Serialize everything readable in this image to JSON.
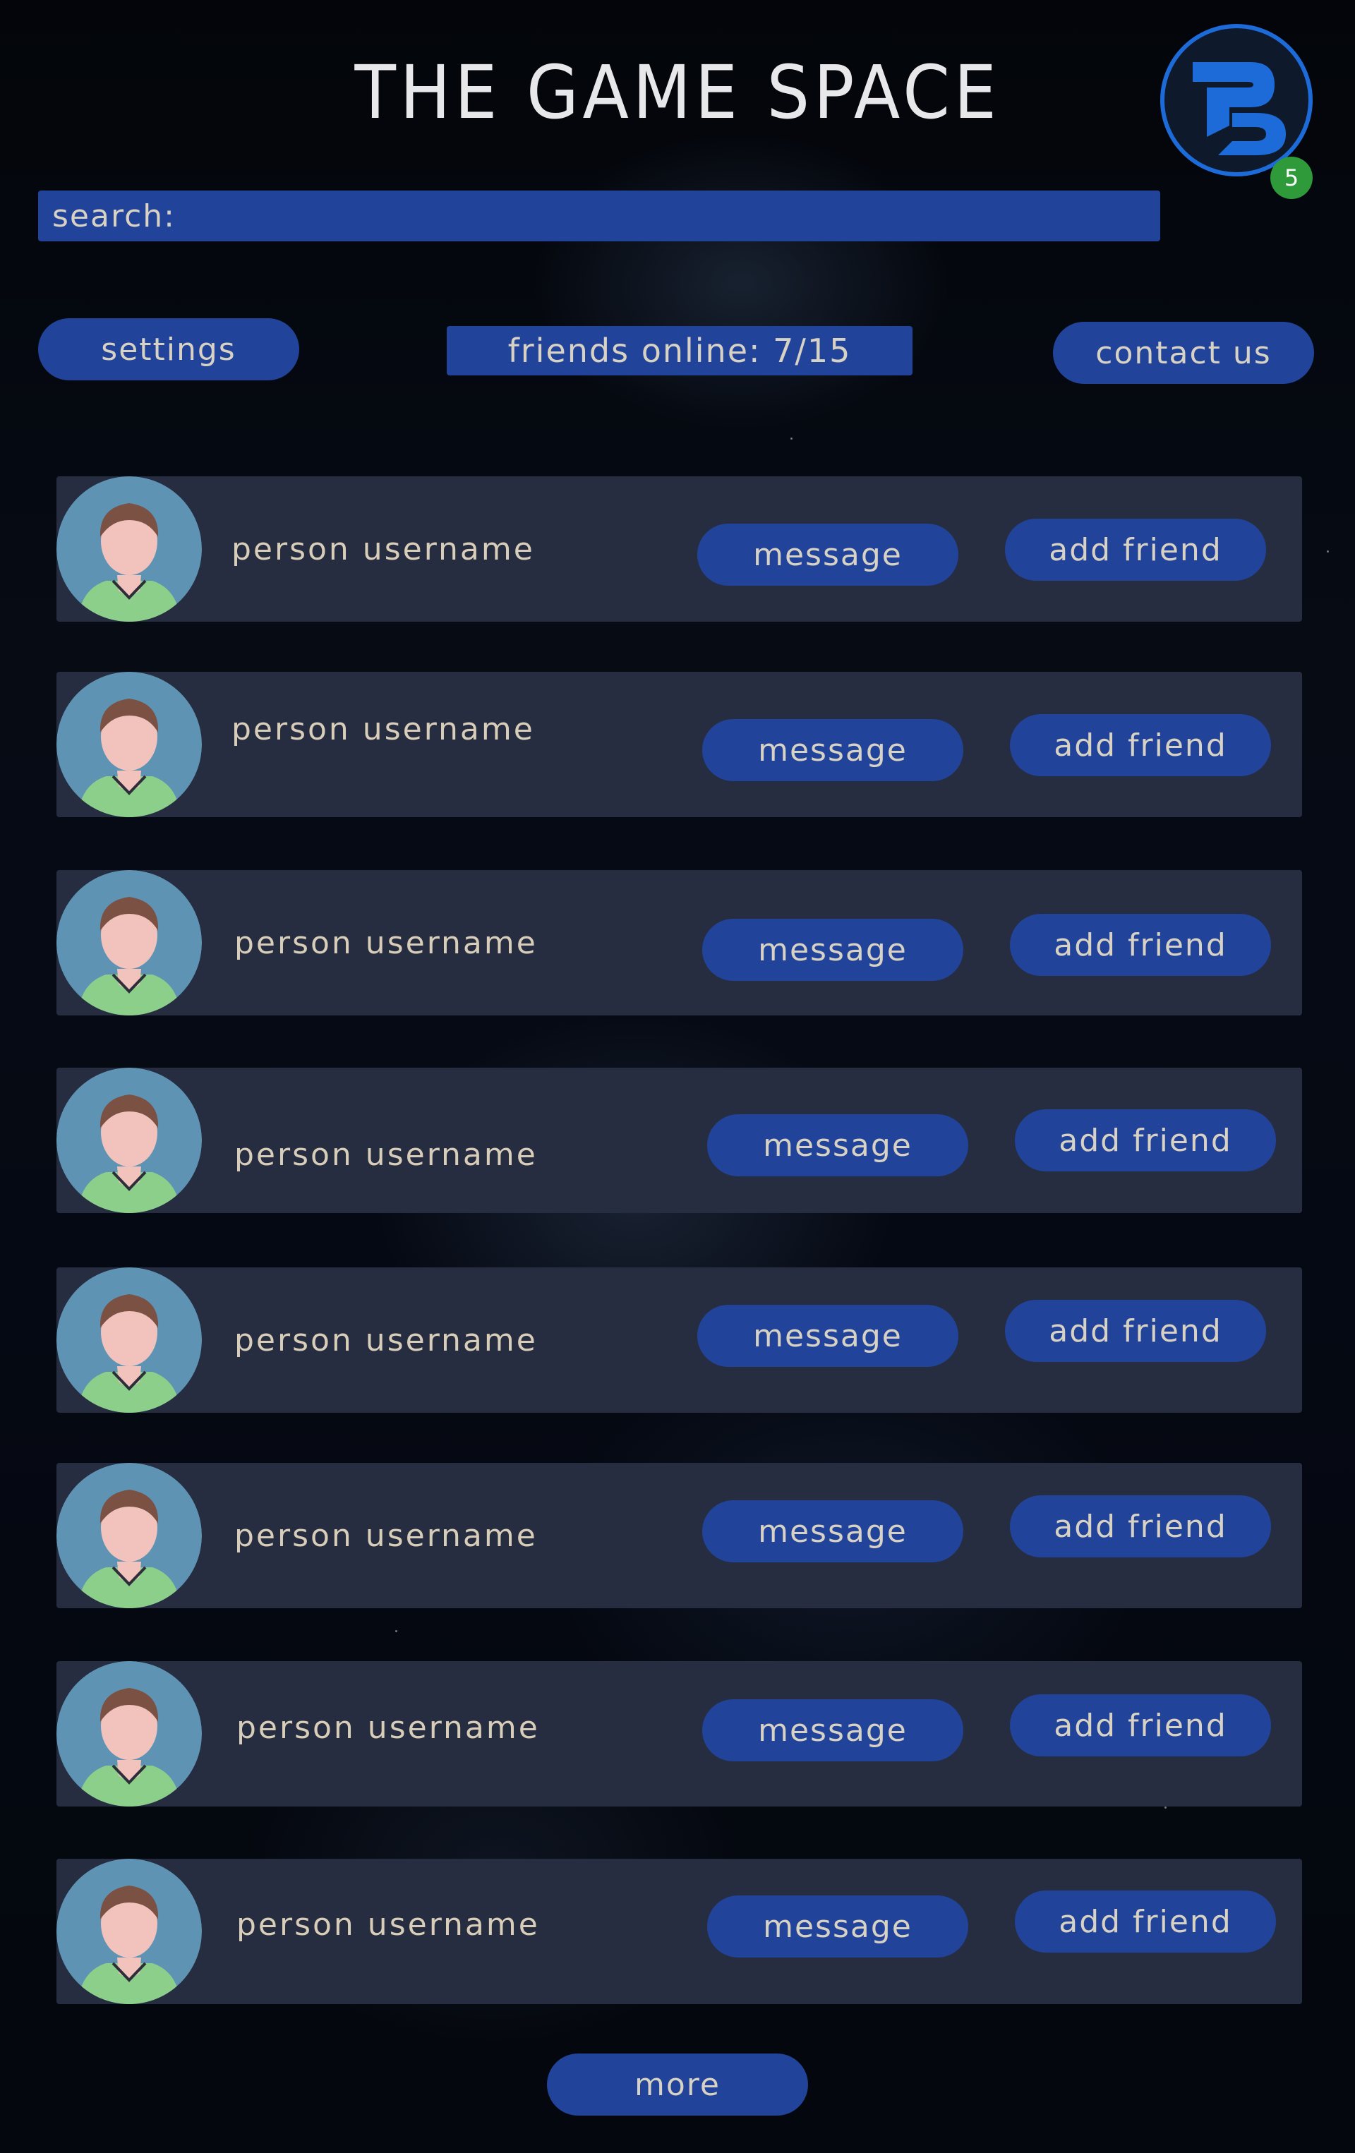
{
  "header": {
    "title": "THE GAME SPACE",
    "logo_icon": "pd-logo-icon",
    "notification_count": "5"
  },
  "search": {
    "label": "search:",
    "value": "",
    "placeholder": ""
  },
  "toolbar": {
    "settings_label": "settings",
    "friends_online_label": "friends online: 7/15",
    "contact_label": "contact us"
  },
  "people": [
    {
      "username": "person username",
      "message_label": "message",
      "add_label": "add friend"
    },
    {
      "username": "person username",
      "message_label": "message",
      "add_label": "add friend"
    },
    {
      "username": "person username",
      "message_label": "message",
      "add_label": "add friend"
    },
    {
      "username": "person username",
      "message_label": "message",
      "add_label": "add friend"
    },
    {
      "username": "person username",
      "message_label": "message",
      "add_label": "add friend"
    },
    {
      "username": "person username",
      "message_label": "message",
      "add_label": "add friend"
    },
    {
      "username": "person username",
      "message_label": "message",
      "add_label": "add friend"
    },
    {
      "username": "person username",
      "message_label": "message",
      "add_label": "add friend"
    }
  ],
  "footer": {
    "more_label": "more"
  },
  "colors": {
    "button_blue": "#21449a",
    "card_bg": "#272d41",
    "text": "#d7cdb8",
    "logo_blue": "#1c6bd8",
    "badge_green": "#2e9a3a"
  }
}
